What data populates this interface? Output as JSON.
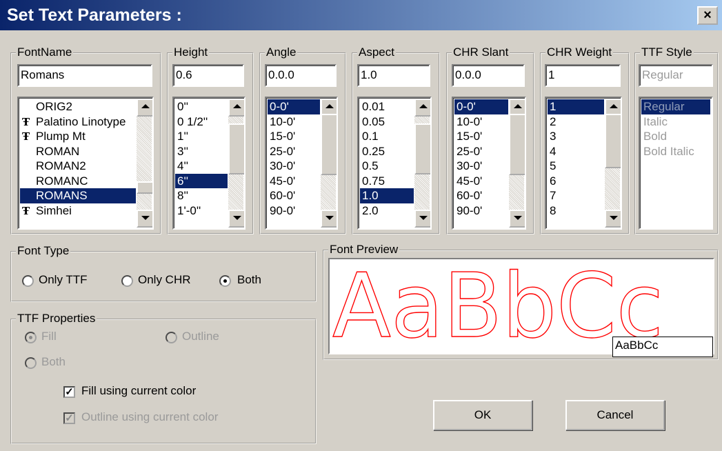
{
  "window": {
    "title": "Set Text Parameters :",
    "close_glyph": "×"
  },
  "fontname": {
    "label": "FontName",
    "value": "Romans",
    "items": [
      {
        "text": "ORIG2",
        "ttf": false
      },
      {
        "text": "Palatino Linotype",
        "ttf": true
      },
      {
        "text": "Plump Mt",
        "ttf": true
      },
      {
        "text": "ROMAN",
        "ttf": false
      },
      {
        "text": "ROMAN2",
        "ttf": false
      },
      {
        "text": "ROMANC",
        "ttf": false
      },
      {
        "text": "ROMANS",
        "ttf": false,
        "selected": true
      },
      {
        "text": "Simhei",
        "ttf": true
      }
    ]
  },
  "height": {
    "label": "Height",
    "value": "0.6",
    "items": [
      "0''",
      "0 1/2''",
      "1''",
      "3''",
      "4''",
      "6''",
      "8''",
      "1'-0''"
    ],
    "selected_index": 5
  },
  "angle": {
    "label": "Angle",
    "value": "0.0.0",
    "items": [
      "0-0'",
      "10-0'",
      "15-0'",
      "25-0'",
      "30-0'",
      "45-0'",
      "60-0'",
      "90-0'"
    ],
    "selected_index": 0
  },
  "aspect": {
    "label": "Aspect",
    "value": "1.0",
    "items": [
      "0.01",
      "0.05",
      "0.1",
      "0.25",
      "0.5",
      "0.75",
      "1.0",
      "2.0"
    ],
    "selected_index": 6
  },
  "chr_slant": {
    "label": "CHR Slant",
    "value": "0.0.0",
    "items": [
      "0-0'",
      "10-0'",
      "15-0'",
      "25-0'",
      "30-0'",
      "45-0'",
      "60-0'",
      "90-0'"
    ],
    "selected_index": 0
  },
  "chr_weight": {
    "label": "CHR Weight",
    "value": "1",
    "items": [
      "1",
      "2",
      "3",
      "4",
      "5",
      "6",
      "7",
      "8"
    ],
    "selected_index": 0
  },
  "ttf_style": {
    "label": "TTF Style",
    "value": "Regular",
    "items": [
      "Regular",
      "Italic",
      "Bold",
      "Bold Italic"
    ],
    "selected_index": 0
  },
  "ttf_icon_glyph": "Ŧ",
  "font_type": {
    "label": "Font Type",
    "only_ttf": "Only TTF",
    "only_chr": "Only CHR",
    "both": "Both",
    "selected": "both"
  },
  "ttf_properties": {
    "label": "TTF Properties",
    "fill": "Fill",
    "outline": "Outline",
    "both": "Both",
    "fill_current_color": "Fill using current color",
    "outline_current_color": "Outline using current color"
  },
  "font_preview": {
    "label": "Font Preview",
    "sample_text": "AaBbCc",
    "input_value": "AaBbCc",
    "color": "#ff0000"
  },
  "buttons": {
    "ok": "OK",
    "cancel": "Cancel"
  },
  "check_glyph": "✓"
}
